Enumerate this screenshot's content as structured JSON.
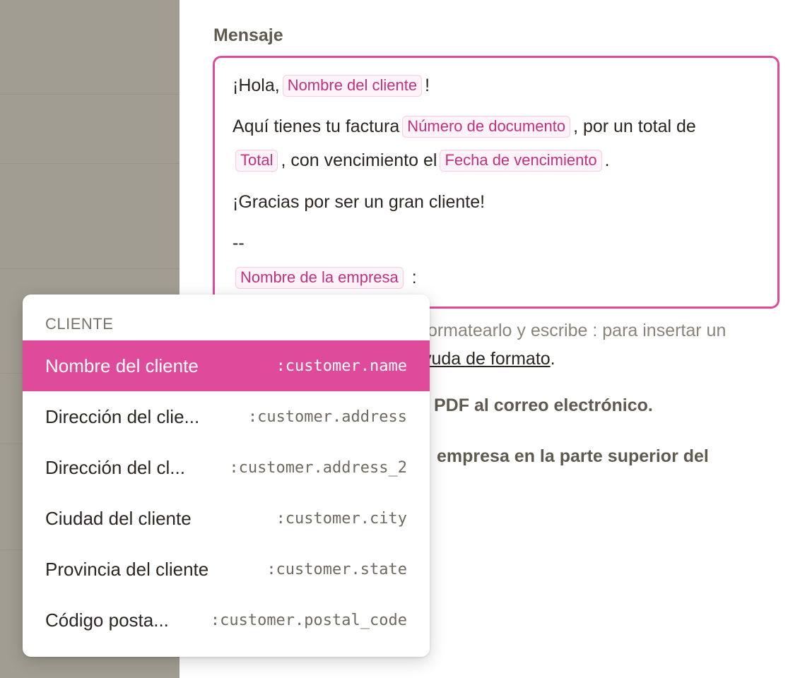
{
  "colors": {
    "accent": "#e04a9a",
    "sidebar_bg": "#a19d92",
    "token_text": "#c0327f"
  },
  "message": {
    "title": "Mensaje",
    "line1": {
      "prefix": "¡Hola,",
      "token": "Nombre del cliente",
      "suffix": "!"
    },
    "line2": {
      "prefix": "Aquí tienes tu factura",
      "token": "Número de documento",
      "suffix": ", por un total de"
    },
    "line3": {
      "token1": "Total",
      "middle": ", con vencimiento el",
      "token2": "Fecha de vencimiento",
      "suffix": "."
    },
    "line4": "¡Gracias por ser un gran cliente!",
    "line5": "--",
    "line6": {
      "token": "Nombre de la empresa",
      "suffix": ":"
    }
  },
  "help": {
    "text": "formatearlo y escribe : para insertar un",
    "link": "yuda de formato",
    "dot": "."
  },
  "options": {
    "attach_pdf": "PDF al correo electrónico.",
    "logo_top": "empresa en la parte superior del"
  },
  "dropdown": {
    "header": "CLIENTE",
    "items": [
      {
        "label": "Nombre del cliente",
        "code": ":customer.name"
      },
      {
        "label": "Dirección del clie...",
        "code": ":customer.address"
      },
      {
        "label": "Dirección del cl...",
        "code": ":customer.address_2"
      },
      {
        "label": "Ciudad del cliente",
        "code": ":customer.city"
      },
      {
        "label": "Provincia del cliente",
        "code": ":customer.state"
      },
      {
        "label": "Código posta...",
        "code": ":customer.postal_code"
      }
    ]
  }
}
